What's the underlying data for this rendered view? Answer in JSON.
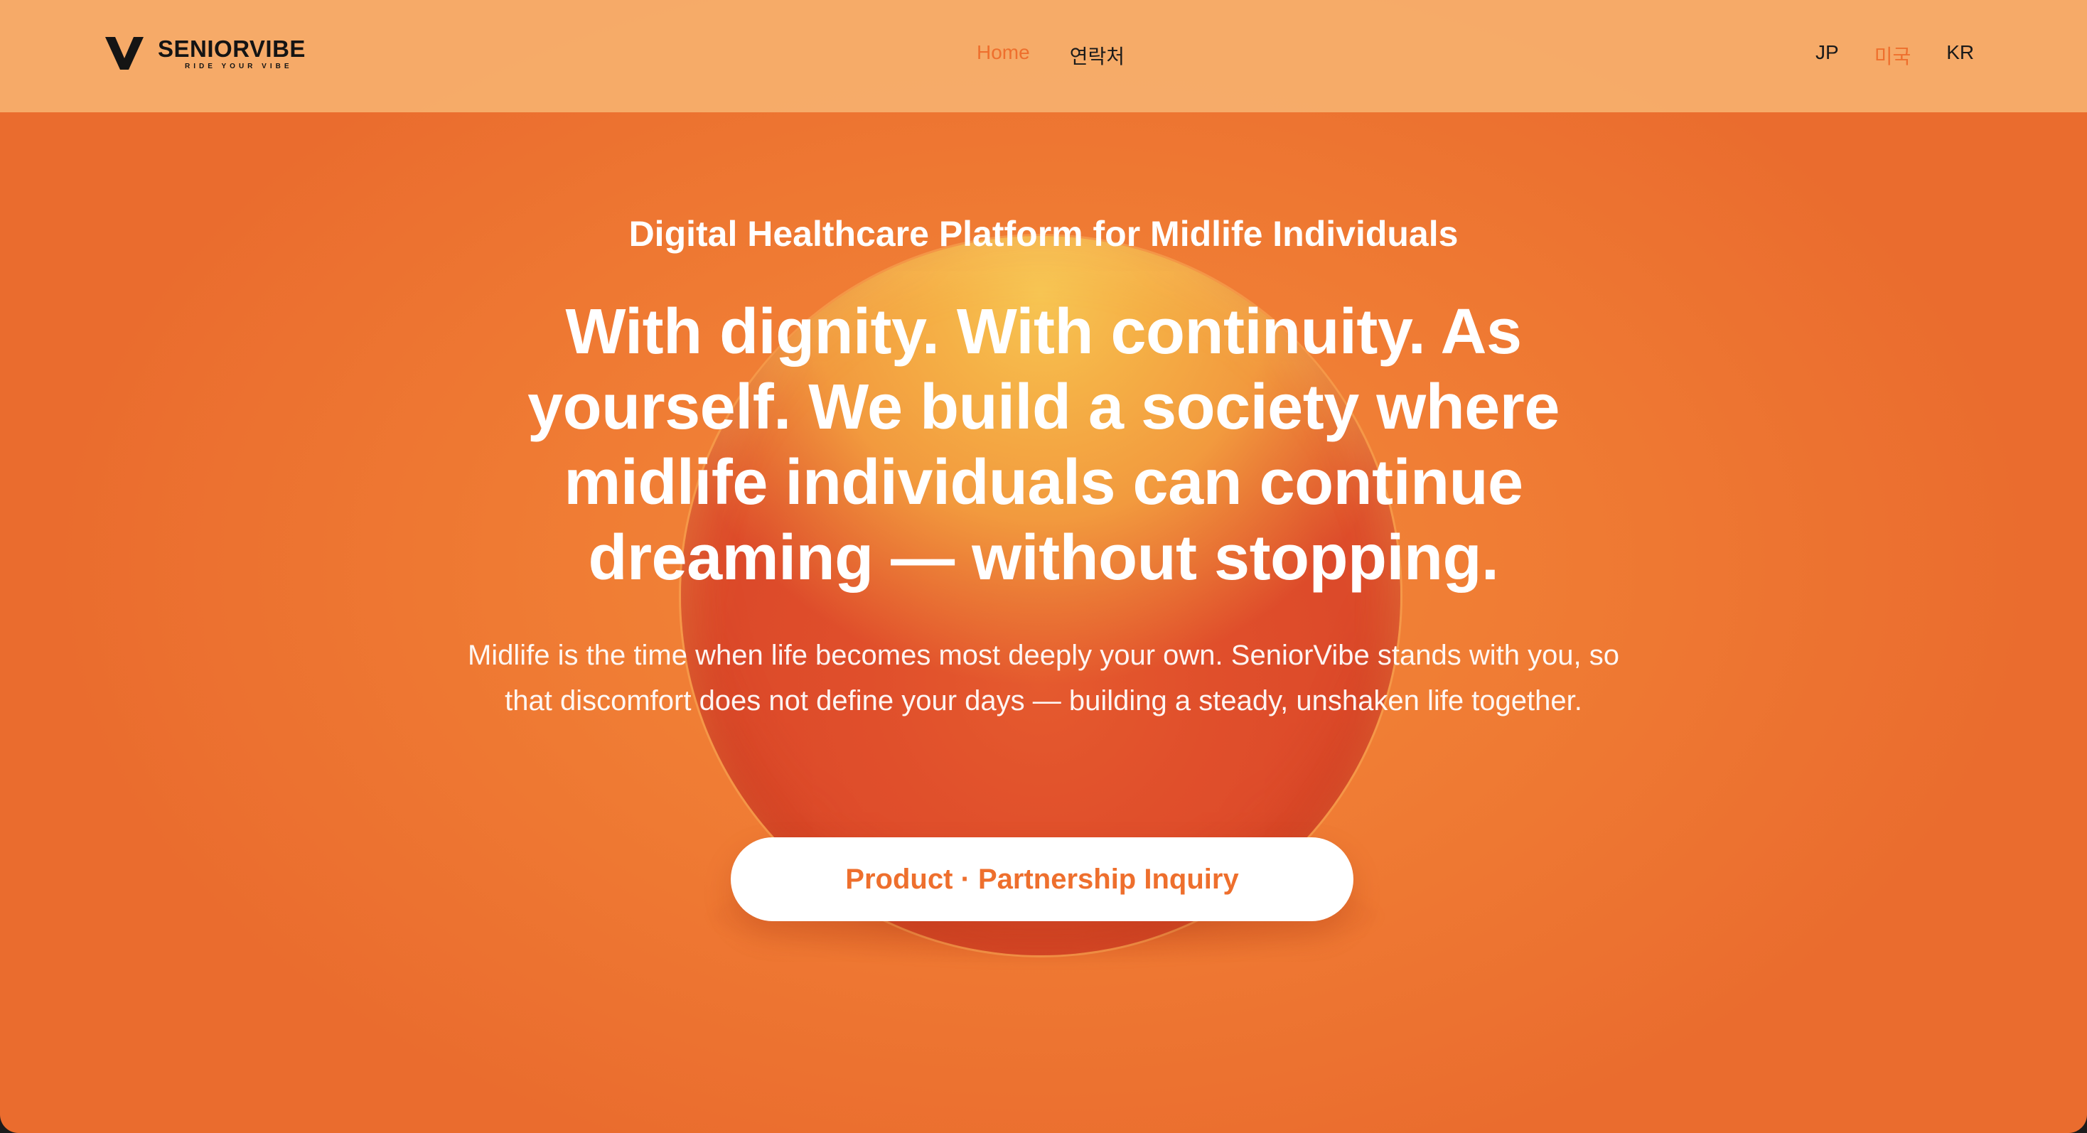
{
  "brand": {
    "name": "SENIORVIBE",
    "tagline": "RIDE YOUR VIBE",
    "icon": "v-logo-icon"
  },
  "nav": {
    "items": [
      {
        "label": "Home",
        "active": true
      },
      {
        "label": "연락처",
        "active": false
      }
    ]
  },
  "languages": {
    "items": [
      {
        "label": "JP",
        "active": false
      },
      {
        "label": "미국",
        "active": true
      },
      {
        "label": "KR",
        "active": false
      }
    ]
  },
  "hero": {
    "eyebrow": "Digital Healthcare Platform for Midlife Individuals",
    "headline": "With dignity. With continuity. As yourself. We build a society where midlife individuals can continue dreaming — without stopping.",
    "subtext": "Midlife is the time when life becomes most deeply your own. SeniorVibe stands with you, so that discomfort does not define your days — building a steady, unshaken life together.",
    "cta_label": "Product · Partnership Inquiry"
  },
  "colors": {
    "accent": "#ee6f2d",
    "background": "#ef7a33",
    "header": "#f6b06e",
    "text_light": "#ffffff"
  }
}
